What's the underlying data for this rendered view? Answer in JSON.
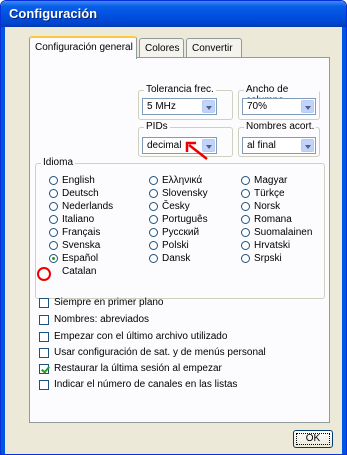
{
  "window": {
    "title": "Configuración"
  },
  "tabs": [
    "Configuración general",
    "Colores",
    "Convertir"
  ],
  "settings": {
    "tolerancia": {
      "label": "Tolerancia frec.",
      "value": "5 MHz"
    },
    "ancho": {
      "label": "Ancho de columna",
      "value": "70%"
    },
    "pids": {
      "label": "PIDs",
      "value": "decimal"
    },
    "nombres": {
      "label": "Nombres acort.",
      "value": "al final"
    }
  },
  "idioma": {
    "label": "Idioma",
    "selected": "Español",
    "options": [
      "English",
      "Deutsch",
      "Nederlands",
      "Italiano",
      "Français",
      "Svenska",
      "Español",
      "Catalan",
      "Ελληνικά",
      "Slovensky",
      "Česky",
      "Português",
      "Русский",
      "Polski",
      "Dansk",
      "Magyar",
      "Türkçe",
      "Norsk",
      "Romana",
      "Suomalainen",
      "Hrvatski",
      "Srpski"
    ]
  },
  "options": [
    {
      "label": "Siempre en primer plano",
      "checked": false
    },
    {
      "label": "Nombres: abreviados",
      "checked": false
    },
    {
      "label": "Empezar con el último archivo utilizado",
      "checked": false
    },
    {
      "label": "Usar configuración de sat. y de menús personal",
      "checked": false
    },
    {
      "label": "Restaurar la última sesión al empezar",
      "checked": true
    },
    {
      "label": "Indicar el número de canales en las listas",
      "checked": false
    }
  ],
  "ok_label": "OK",
  "colors": {
    "annotation": "#ee0000",
    "title_bar": "#0050e0"
  },
  "icons": {
    "annotation_arrow": "red-arrow-icon",
    "annotation_circle": "red-circle-icon"
  }
}
